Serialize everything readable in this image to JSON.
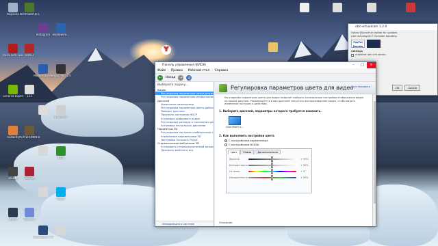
{
  "desktop": {
    "icons_left": [
      {
        "label": "Корзина",
        "color": "#9fb3c8"
      },
      {
        "label": "TechPowerUp GPU-Z",
        "color": "#4b7a2a"
      },
      {
        "label": "Instagram",
        "color": "#6b3f8f"
      },
      {
        "label": "windows-k...",
        "color": "#2a66b0"
      },
      {
        "label": "ASUS GPU Tweak II",
        "color": "#b01c1c"
      },
      {
        "label": "Dota 2",
        "color": "#b02a2a"
      },
      {
        "label": "Malwarebytes",
        "color": "#2a5db0"
      },
      {
        "label": "Vegas Pro 13.0 (64-bit)",
        "color": "#333333"
      },
      {
        "label": "GeForce Experience",
        "color": "#76b900"
      },
      {
        "label": "123",
        "color": "#dddddd"
      },
      {
        "label": "",
        "color": "#dddddd"
      },
      {
        "label": "pacMan4",
        "color": "#cfcfcf"
      },
      {
        "label": "Audacity",
        "color": "#e0813a"
      },
      {
        "label": "PLAYERUNKN BATTLEGR...",
        "color": "#6b5a3a"
      },
      {
        "label": "",
        "color": "#d8d8d8"
      },
      {
        "label": "Xbox",
        "color": "#2f8f2f"
      },
      {
        "label": "Stalker",
        "color": "#444444"
      },
      {
        "label": "GOTHA",
        "color": "#aa2233"
      },
      {
        "label": "",
        "color": "#d8d8d8"
      },
      {
        "label": "Skype",
        "color": "#00aff0"
      },
      {
        "label": "Steam",
        "color": "#2a3a4e"
      },
      {
        "label": "Discord",
        "color": "#7289da"
      },
      {
        "label": "TeamSpeak 3 Client",
        "color": "#2a4a7e"
      },
      {
        "label": "",
        "color": "#d8d8d8"
      }
    ],
    "icons_right": [
      {
        "label": "",
        "color": "#eeeeee"
      },
      {
        "label": "",
        "color": "#d8d8d8"
      },
      {
        "label": "",
        "color": "#d8d8d8"
      },
      {
        "label": "",
        "color": "#c83a3a"
      }
    ],
    "yandex_label": "Y",
    "folder_icon": "folder-icon"
  },
  "obs_window": {
    "title": "obs-virtualcam 1.2.0",
    "line1": "Follow @jurasfi on twitter for updates",
    "line2": "Like the program? Consider donating",
    "settings": "Settings",
    "autostart": "Autostart obs-virtualcam",
    "paypal": "PayPal Donate",
    "ok_button": "OK",
    "cancel_button": "Cancel"
  },
  "nvidia": {
    "window_title": "Панель управления NVIDIA",
    "menu": [
      "Файл",
      "Правка",
      "Рабочий стол",
      "Справка"
    ],
    "back_label": "Назад",
    "task_title": "Выберите задачу...",
    "tree": [
      {
        "text": "Видео",
        "kind": "cat"
      },
      {
        "text": "Регулировка параметров цвета для видео",
        "kind": "sel"
      },
      {
        "text": "Регулировка параметров изображения для видео",
        "kind": "sub"
      },
      {
        "text": "Дисплей",
        "kind": "cat"
      },
      {
        "text": "Изменение разрешения",
        "kind": "sub"
      },
      {
        "text": "Регулировка параметров цвета рабочего стола",
        "kind": "sub"
      },
      {
        "text": "Поворот дисплея",
        "kind": "sub"
      },
      {
        "text": "Просмотр состояния HDCP",
        "kind": "sub"
      },
      {
        "text": "Установка цифрового аудио",
        "kind": "sub"
      },
      {
        "text": "Регулировка размера и положения рабочего стола",
        "kind": "sub"
      },
      {
        "text": "Установка нескольких дисплеев",
        "kind": "sub"
      },
      {
        "text": "Параметры 3D",
        "kind": "cat"
      },
      {
        "text": "Регулировка настроек изображения с просмотром",
        "kind": "sub"
      },
      {
        "text": "Управление параметрами 3D",
        "kind": "sub"
      },
      {
        "text": "Настройка Surround, PhysX",
        "kind": "sub"
      },
      {
        "text": "Стереоскопический режим 3D",
        "kind": "cat"
      },
      {
        "text": "Установить стереоскопический режим 3D",
        "kind": "sub"
      },
      {
        "text": "Просмотр рейтинга игр",
        "kind": "sub"
      }
    ],
    "help_link": "Информация о системе",
    "page_title": "Регулировка параметров цвета для видео",
    "restore_link": "Восстановить",
    "description": "Регулировка параметров цвета для видео позволит выбрать оптимальные настройки отображения видео на вашем дисплее. Рекомендуется в ваш дисплей запустить воспроизведение видео, чтобы видеть изменение настроек в действии.",
    "section1": "1. Выберите дисплей, параметры которого требуется изменить.",
    "monitor_caption": "Акитсбайт д...",
    "section2": "2. Как выполнить настройки цвета",
    "radio1": "С настройками видеоплеера",
    "radio2": "С настройками NVIDIA",
    "tabs": [
      "Цвет",
      "Гамма",
      "Дополнительно"
    ],
    "sliders": [
      {
        "label": "Яркость:",
        "value": "+ 50%",
        "pos": 0.5,
        "grad": "linear-gradient(90deg,#222,#fff)"
      },
      {
        "label": "Контрастность:",
        "value": "+ 50%",
        "pos": 0.5,
        "grad": "linear-gradient(90deg,#777,#fff)"
      },
      {
        "label": "Оттенок:",
        "value": "+ 0°",
        "pos": 0.5,
        "grad": "linear-gradient(90deg,#f00,#ff0,#0f0,#0ff,#00f,#f0f,#f00)"
      },
      {
        "label": "Насыщенность:",
        "value": "+ 50%",
        "pos": 0.5,
        "grad": "linear-gradient(90deg,#999,#c33,#3c3,#33c)"
      }
    ],
    "footer": "Описание"
  },
  "recycle_bin_label": "Корзина"
}
